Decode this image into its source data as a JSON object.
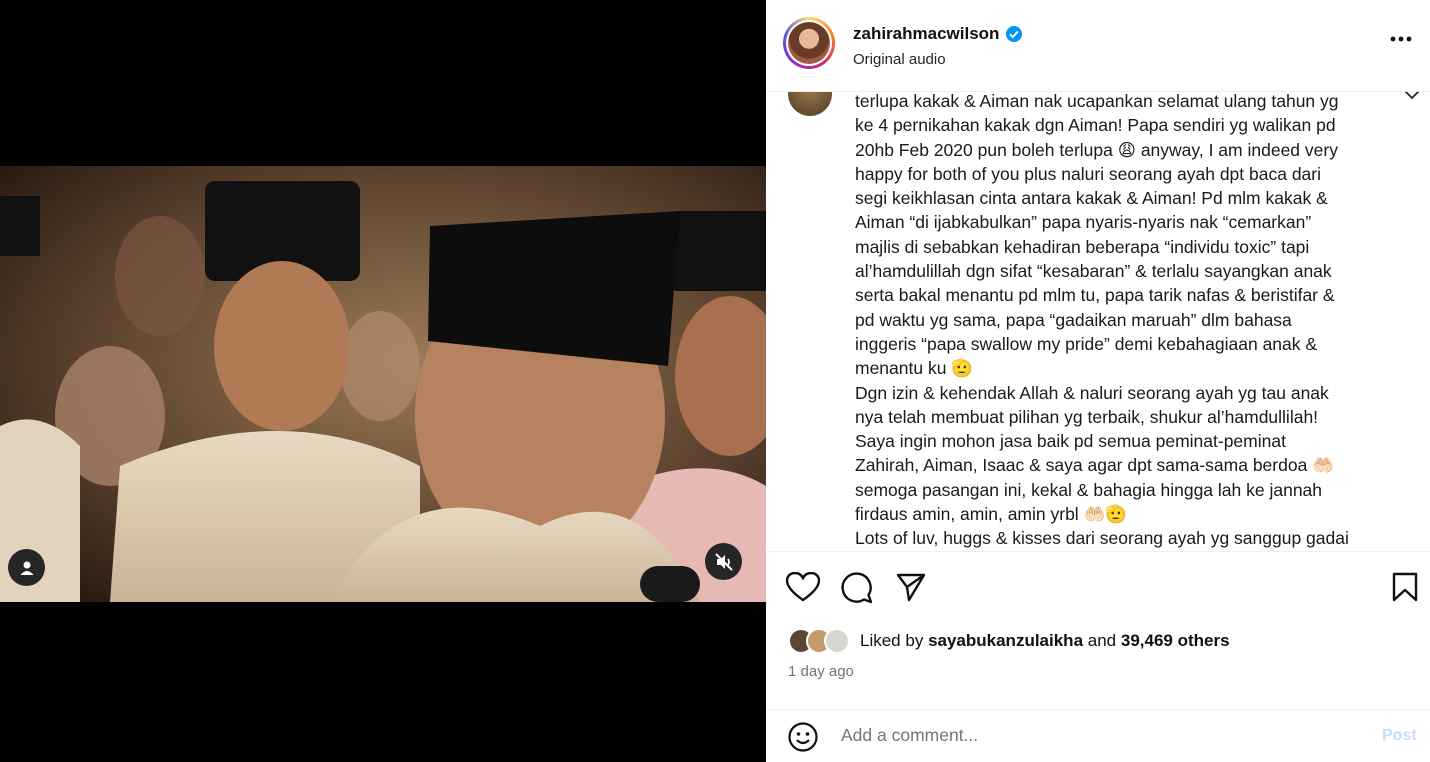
{
  "post": {
    "username": "zahirahmacwilson",
    "audio": "Original audio",
    "caption": "terlupa kakak & Aiman nak ucapankan selamat ulang tahun yg\nke 4 pernikahan kakak dgn Aiman! Papa sendiri yg walikan pd\n20hb Feb 2020 pun boleh terlupa 😩 anyway, I am indeed very\nhappy for both of you plus naluri seorang ayah dpt baca dari\nsegi keikhlasan cinta antara kakak & Aiman! Pd mlm kakak &\nAiman “di ijabkabulkan” papa nyaris-nyaris nak “cemarkan”\nmajlis di sebabkan kehadiran beberapa “individu toxic” tapi\nal’hamdulillah dgn sifat “kesabaran” & terlalu sayangkan anak\nserta bakal menantu pd mlm tu, papa tarik nafas & beristifar &\npd waktu yg sama, papa “gadaikan maruah” dlm bahasa\ninggeris “papa swallow my pride” demi kebahagiaan anak &\nmenantu ku 🫡\nDgn izin & kehendak Allah & naluri seorang ayah yg tau anak\nnya telah membuat pilihan yg terbaik, shukur al’hamdullilah!\nSaya ingin mohon jasa baik pd semua peminat-peminat\nZahirah, Aiman, Isaac & saya agar dpt sama-sama berdoa 🤲🏻\nsemoga pasangan ini, kekal & bahagia hingga lah ke jannah\nfirdaus amin, amin, amin yrbl 🤲🏻🫡\nLots of luv, huggs & kisses dari seorang ayah yg sanggup gadai",
    "liked_by_prefix": "Liked by",
    "liked_by_user": "sayabukanzulaikha",
    "liked_and": "and",
    "liked_others": "39,469 others",
    "time": "1 day ago",
    "comment_placeholder": "Add a comment...",
    "post_label": "Post"
  },
  "colors": {
    "accent_blue": "#0095f6",
    "post_disabled": "#c5dcfa",
    "muted_text": "#737373"
  },
  "icons": [
    "verified-icon",
    "more-icon",
    "chevron-down-icon",
    "heart-icon",
    "comment-icon",
    "share-icon",
    "bookmark-icon",
    "emoji-icon",
    "user-tag-icon",
    "mute-icon"
  ]
}
